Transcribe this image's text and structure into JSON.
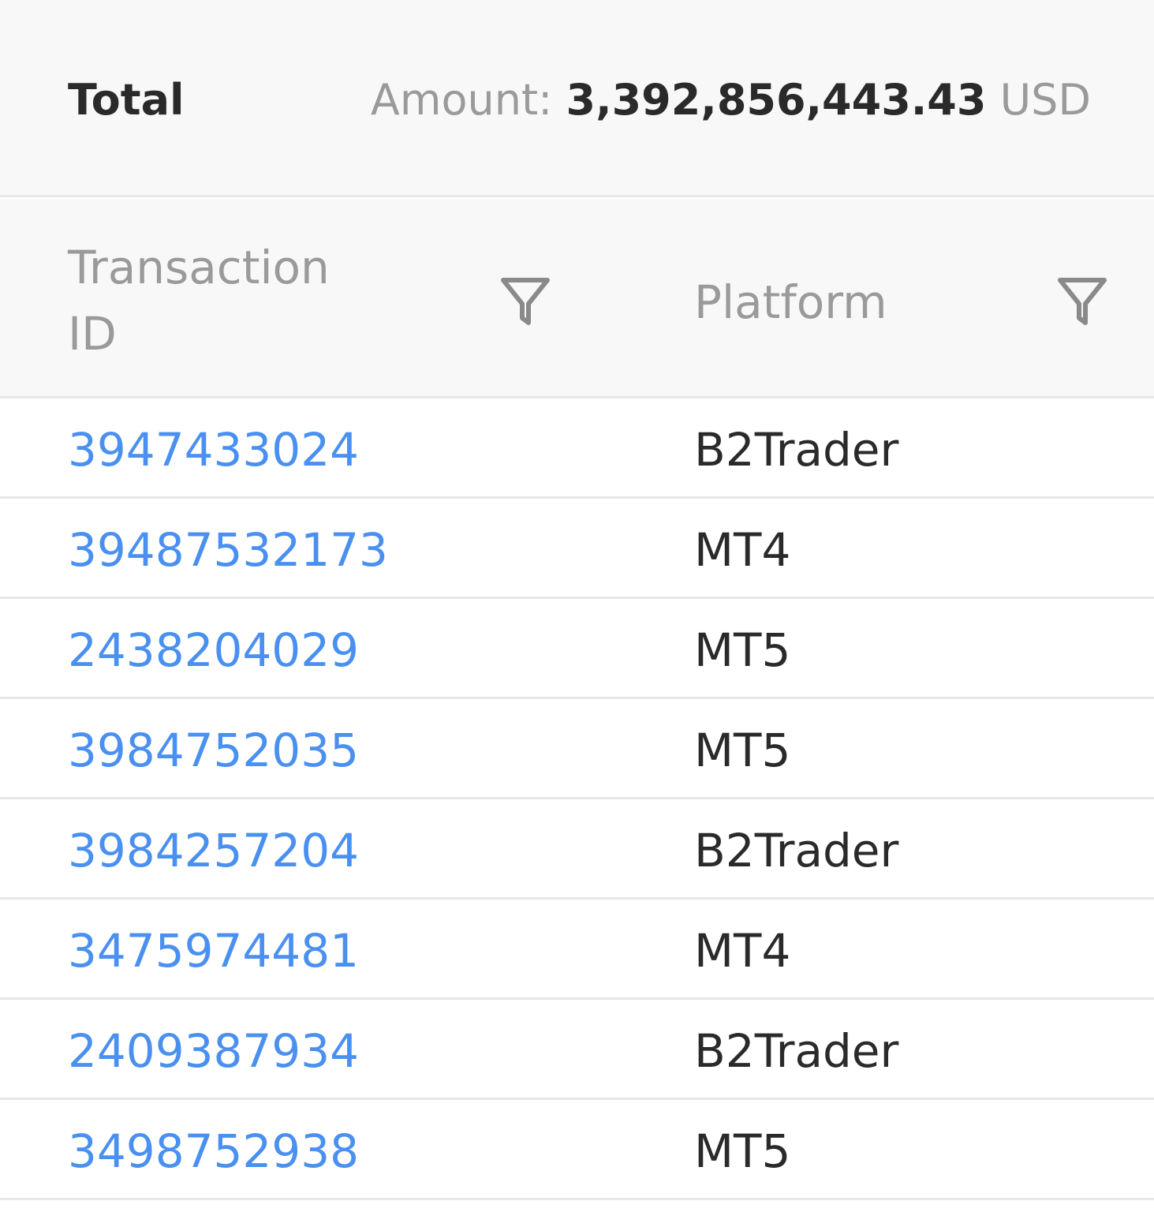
{
  "summary": {
    "label": "Total",
    "amount_prefix": "Amount:",
    "amount_value": "3,392,856,443.43",
    "amount_currency": "USD"
  },
  "columns": {
    "transaction_id": "Transaction ID",
    "platform": "Platform"
  },
  "icons": {
    "filter": "filter-icon"
  },
  "colors": {
    "link": "#4a90f0",
    "text": "#2a2a2a",
    "muted": "#9a9a9a",
    "header_bg": "#f7f8f7",
    "divider": "#e6e8e6"
  },
  "rows": [
    {
      "id": "3947433024",
      "platform": "B2Trader"
    },
    {
      "id": "39487532173",
      "platform": "MT4"
    },
    {
      "id": "2438204029",
      "platform": "MT5"
    },
    {
      "id": "3984752035",
      "platform": "MT5"
    },
    {
      "id": "3984257204",
      "platform": "B2Trader"
    },
    {
      "id": "3475974481",
      "platform": "MT4"
    },
    {
      "id": "2409387934",
      "platform": "B2Trader"
    },
    {
      "id": "3498752938",
      "platform": "MT5"
    }
  ]
}
